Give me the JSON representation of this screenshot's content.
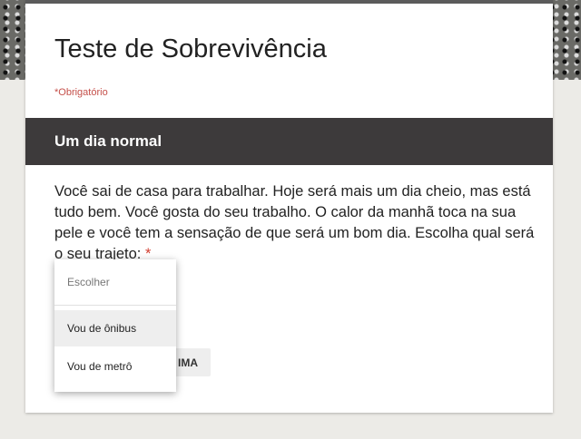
{
  "form": {
    "title": "Teste de Sobrevivência",
    "required_note": "*Obrigatório"
  },
  "section": {
    "title": "Um dia normal"
  },
  "question": {
    "text": "Você sai de casa para trabalhar. Hoje será mais um dia cheio, mas está tudo bem. Você gosta do seu trabalho. O calor da manhã toca na sua pele e você tem a sensação de que será um bom dia. Escolha qual será o seu trajeto:",
    "required_marker": "*"
  },
  "dropdown": {
    "placeholder": "Escolher",
    "options": [
      "Vou de ônibus",
      "Vou de metrô"
    ],
    "highlighted_index": 0
  },
  "buttons": {
    "next_label_visible": "IMA"
  },
  "colors": {
    "section_bar": "#3d3a3b",
    "required": "#c5504a",
    "card": "#ffffff",
    "page_bg": "#ecebe7"
  }
}
